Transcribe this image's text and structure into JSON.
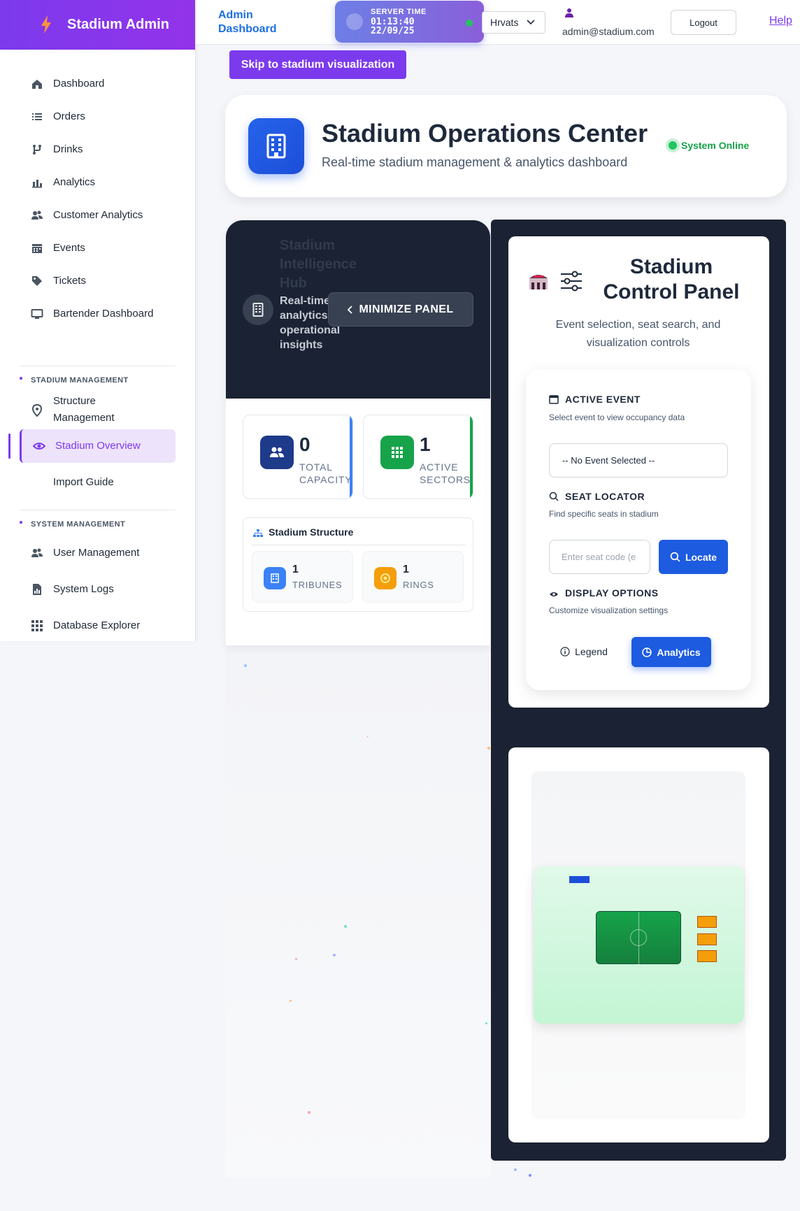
{
  "brand": {
    "name": "Stadium Admin",
    "accent": "#7c3aed"
  },
  "sidebar": {
    "items": [
      {
        "label": "Dashboard",
        "icon": "home-icon"
      },
      {
        "label": "Orders",
        "icon": "list-icon"
      },
      {
        "label": "Drinks",
        "icon": "drink-icon"
      },
      {
        "label": "Analytics",
        "icon": "bar-chart-icon"
      },
      {
        "label": "Customer Analytics",
        "icon": "users-icon"
      },
      {
        "label": "Events",
        "icon": "calendar-icon"
      },
      {
        "label": "Tickets",
        "icon": "tag-icon"
      },
      {
        "label": "Bartender Dashboard",
        "icon": "monitor-icon"
      }
    ],
    "stadium_section": {
      "title": "STADIUM MANAGEMENT",
      "items": [
        {
          "label": "Structure Management",
          "icon": "map-pin-icon"
        },
        {
          "label": "Stadium Overview",
          "icon": "eye-icon",
          "active": true
        },
        {
          "label": "Import Guide",
          "icon": ""
        }
      ]
    },
    "system_section": {
      "title": "SYSTEM MANAGEMENT",
      "items": [
        {
          "label": "User Management",
          "icon": "users-icon"
        },
        {
          "label": "System Logs",
          "icon": "file-chart-icon"
        },
        {
          "label": "Database Explorer",
          "icon": "grid-icon"
        }
      ]
    }
  },
  "topbar": {
    "title": "Admin Dashboard",
    "server_time_label": "SERVER TIME",
    "server_time": "01:13:40",
    "server_date": "22/09/25",
    "language": "Hrvats",
    "user_email": "admin@stadium.com",
    "logout_label": "Logout",
    "help_label": "Help"
  },
  "skip_link": "Skip to stadium visualization",
  "header": {
    "title": "Stadium Operations Center",
    "subtitle": "Real-time stadium management & analytics dashboard",
    "status": "System Online"
  },
  "hub": {
    "title": "Stadium Intelligence Hub",
    "subtitle": "Real-time analytics & operational insights",
    "minimize_label": "MINIMIZE PANEL",
    "stats": [
      {
        "value": "0",
        "label": "TOTAL CAPACITY",
        "color": "#1e3a8a",
        "edge": "#3b82f6"
      },
      {
        "value": "1",
        "label": "ACTIVE SECTORS",
        "color": "#16a34a",
        "edge": "#16a34a"
      }
    ],
    "structure": {
      "title": "Stadium Structure",
      "items": [
        {
          "value": "1",
          "label": "TRIBUNES",
          "color": "#3b82f6"
        },
        {
          "value": "1",
          "label": "RINGS",
          "color": "#f59e0b"
        }
      ]
    }
  },
  "control_panel": {
    "title": "Stadium Control Panel",
    "subtitle": "Event selection, seat search, and visualization controls",
    "active_event": {
      "heading": "ACTIVE EVENT",
      "desc": "Select event to view occupancy data",
      "selected": "-- No Event Selected --"
    },
    "seat_locator": {
      "heading": "SEAT LOCATOR",
      "desc": "Find specific seats in stadium",
      "placeholder": "Enter seat code (e",
      "button": "Locate"
    },
    "display_options": {
      "heading": "DISPLAY OPTIONS",
      "desc": "Customize visualization settings",
      "legend_button": "Legend",
      "analytics_button": "Analytics"
    }
  }
}
